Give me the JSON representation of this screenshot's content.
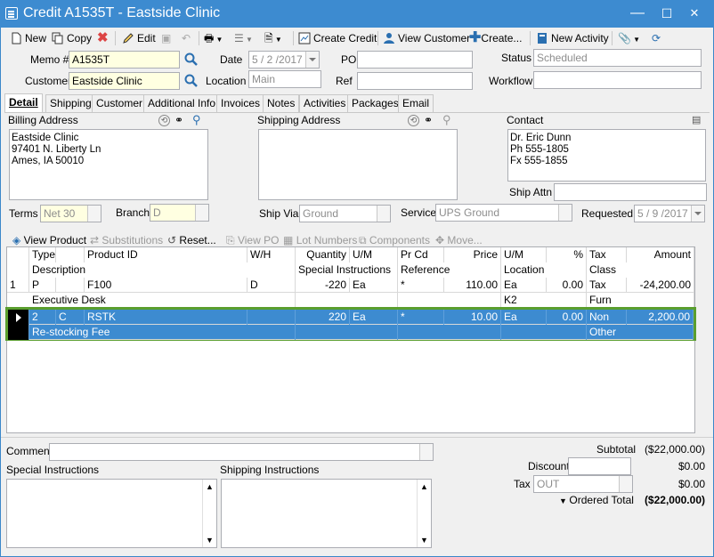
{
  "window": {
    "title": "Credit A1535T - Eastside Clinic",
    "minimize": "—",
    "maximize": "☐",
    "close": "✕"
  },
  "toolbar": {
    "new": "New",
    "copy": "Copy",
    "edit": "Edit",
    "create_credit": "Create Credit",
    "view_customer": "View Customer",
    "create": "Create...",
    "new_activity": "New Activity"
  },
  "header": {
    "memo_label": "Memo #",
    "memo_value": "A1535T",
    "date_label": "Date",
    "date_value": "5 / 2 /2017",
    "po_label": "PO",
    "po_value": "",
    "status_label": "Status",
    "status_value": "Scheduled",
    "customer_label": "Customer",
    "customer_value": "Eastside Clinic",
    "location_label": "Location",
    "location_value": "Main",
    "ref_label": "Ref",
    "ref_value": "",
    "workflow_label": "Workflow",
    "workflow_value": ""
  },
  "tabs": [
    "Detail",
    "Shipping",
    "Customer",
    "Additional Info",
    "Invoices",
    "Notes",
    "Activities",
    "Packages",
    "Email"
  ],
  "detail": {
    "billing_label": "Billing Address",
    "billing_lines": [
      "Eastside Clinic",
      "97401 N. Liberty Ln",
      "Ames, IA 50010"
    ],
    "shipping_label": "Shipping Address",
    "contact_label": "Contact",
    "contact_lines": [
      "Dr. Eric Dunn",
      "Ph 555-1805",
      "Fx 555-1855"
    ],
    "ship_attn_label": "Ship Attn",
    "ship_attn_value": "",
    "terms_label": "Terms",
    "terms_value": "Net 30",
    "branch_label": "Branch",
    "branch_value": "D",
    "ship_via_label": "Ship Via",
    "ship_via_value": "Ground",
    "service_label": "Service",
    "service_value": "UPS Ground",
    "requested_label": "Requested",
    "requested_value": "5 / 9 /2017"
  },
  "grid_toolbar": {
    "view_product": "View Product",
    "substitutions": "Substitutions",
    "reset": "Reset...",
    "view_po": "View PO",
    "lot_numbers": "Lot Numbers",
    "components": "Components",
    "move": "Move..."
  },
  "grid": {
    "headers1": [
      "Type",
      "Product ID",
      "W/H",
      "Quantity",
      "U/M",
      "Pr Cd",
      "Price",
      "U/M",
      "%",
      "Tax",
      "Amount"
    ],
    "headers2": [
      "Description",
      "Special Instructions",
      "Reference",
      "Location",
      "Class"
    ],
    "rows": [
      {
        "num": "1",
        "type": "P",
        "product": "F100",
        "wh": "D",
        "qty": "-220",
        "um": "Ea",
        "prcd": "*",
        "price": "110.00",
        "um2": "Ea",
        "pct": "0.00",
        "tax": "Tax",
        "amount": "-24,200.00",
        "desc": "Executive Desk",
        "special": "",
        "ref": "",
        "location": "K2",
        "class": "Furn"
      },
      {
        "num": "2",
        "type": "C",
        "product": "RSTK",
        "wh": "",
        "qty": "220",
        "um": "Ea",
        "prcd": "*",
        "price": "10.00",
        "um2": "Ea",
        "pct": "0.00",
        "tax": "Non",
        "amount": "2,200.00",
        "desc": "Re-stocking Fee",
        "special": "",
        "ref": "",
        "location": "",
        "class": "Other"
      }
    ]
  },
  "footer": {
    "comment_label": "Comment",
    "comment_value": "",
    "special_label": "Special Instructions",
    "shipping_label": "Shipping Instructions",
    "subtotal_label": "Subtotal",
    "subtotal_value": "($22,000.00)",
    "discount_label": "Discount",
    "discount_value": "$0.00",
    "tax_label": "Tax",
    "tax_code": "OUT",
    "tax_value": "$0.00",
    "ordered_total_label": "Ordered Total",
    "ordered_total_value": "($22,000.00)"
  }
}
